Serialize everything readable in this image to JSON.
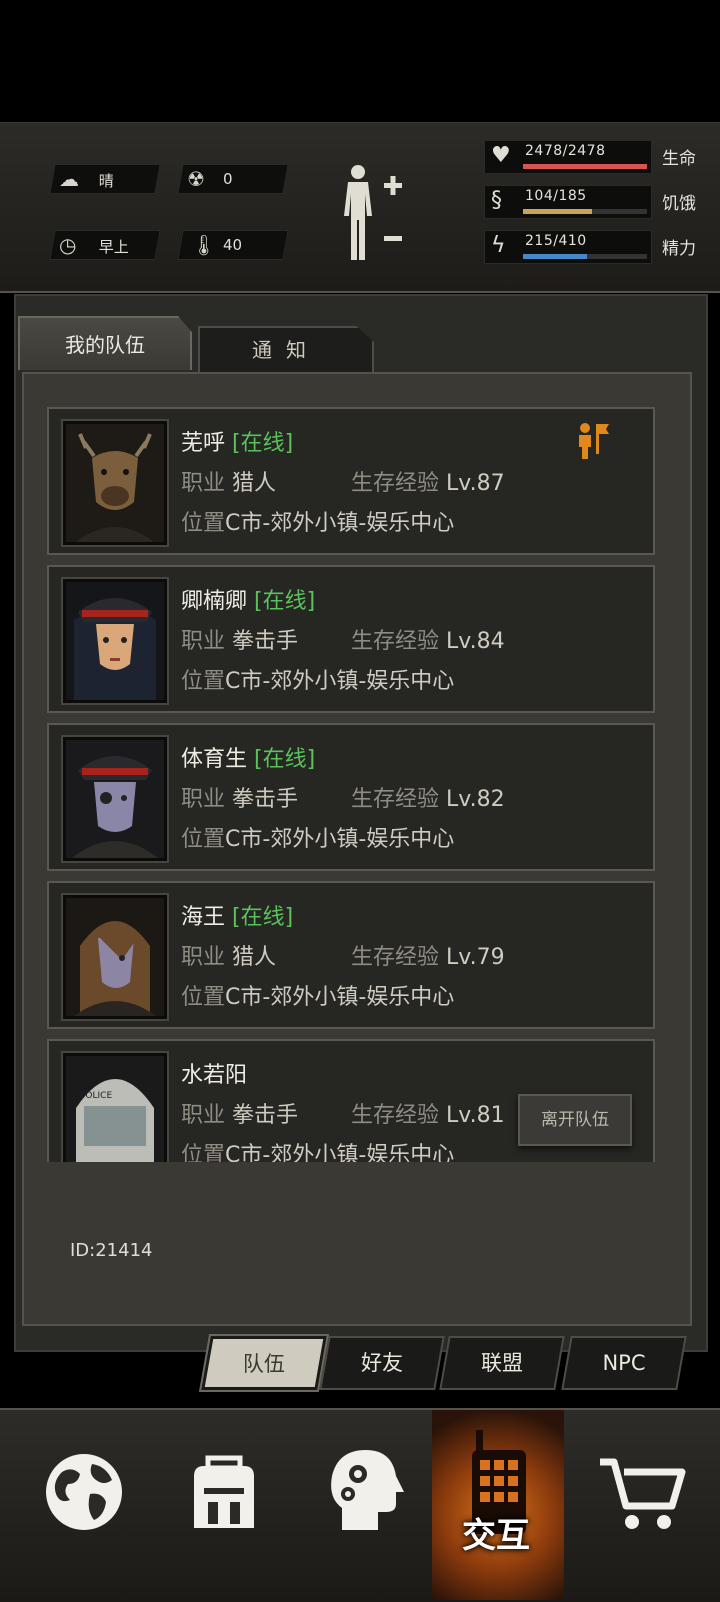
{
  "status": {
    "weather": "晴",
    "radiation": "0",
    "time_of_day": "早上",
    "temperature": "40",
    "health": {
      "value": "2478/2478",
      "label": "生命",
      "fraction": 1.0,
      "color": "#d9534f"
    },
    "hunger": {
      "value": "104/185",
      "label": "饥饿",
      "fraction": 0.56,
      "color": "#c9a45a"
    },
    "energy": {
      "value": "215/410",
      "label": "精力",
      "fraction": 0.52,
      "color": "#4a87c9"
    }
  },
  "tabs": {
    "team": "我的队伍",
    "notice": "通知"
  },
  "labels": {
    "job": "职业",
    "location": "位置",
    "exp": "生存经验",
    "online": "[在线]",
    "leave": "离开队伍"
  },
  "members": [
    {
      "name": "芜呼",
      "online": "[在线]",
      "job": "猎人",
      "level": "Lv.87",
      "location": "C市-郊外小镇-娱乐中心"
    },
    {
      "name": "卿楠卿",
      "online": "[在线]",
      "job": "拳击手",
      "level": "Lv.84",
      "location": "C市-郊外小镇-娱乐中心"
    },
    {
      "name": "体育生",
      "online": "[在线]",
      "job": "拳击手",
      "level": "Lv.82",
      "location": "C市-郊外小镇-娱乐中心"
    },
    {
      "name": "海王",
      "online": "[在线]",
      "job": "猎人",
      "level": "Lv.79",
      "location": "C市-郊外小镇-娱乐中心"
    },
    {
      "name": "水若阳",
      "online": "",
      "job": "拳击手",
      "level": "Lv.81",
      "location": "C市-郊外小镇-娱乐中心"
    }
  ],
  "player_id": "ID:21414",
  "subtabs": [
    "队伍",
    "好友",
    "联盟",
    "NPC"
  ],
  "nav": {
    "interact": "交互"
  },
  "icons": {
    "weather": "cloud-sun-icon",
    "radiation": "radiation-icon",
    "clock": "clock-icon",
    "thermometer": "thermometer-icon",
    "body": "body-icon",
    "leader": "team-leader-flag-icon",
    "world": "globe-icon",
    "backpack": "backpack-icon",
    "skills": "brain-gear-icon",
    "interact": "walkie-talkie-icon",
    "shop": "cart-icon"
  }
}
